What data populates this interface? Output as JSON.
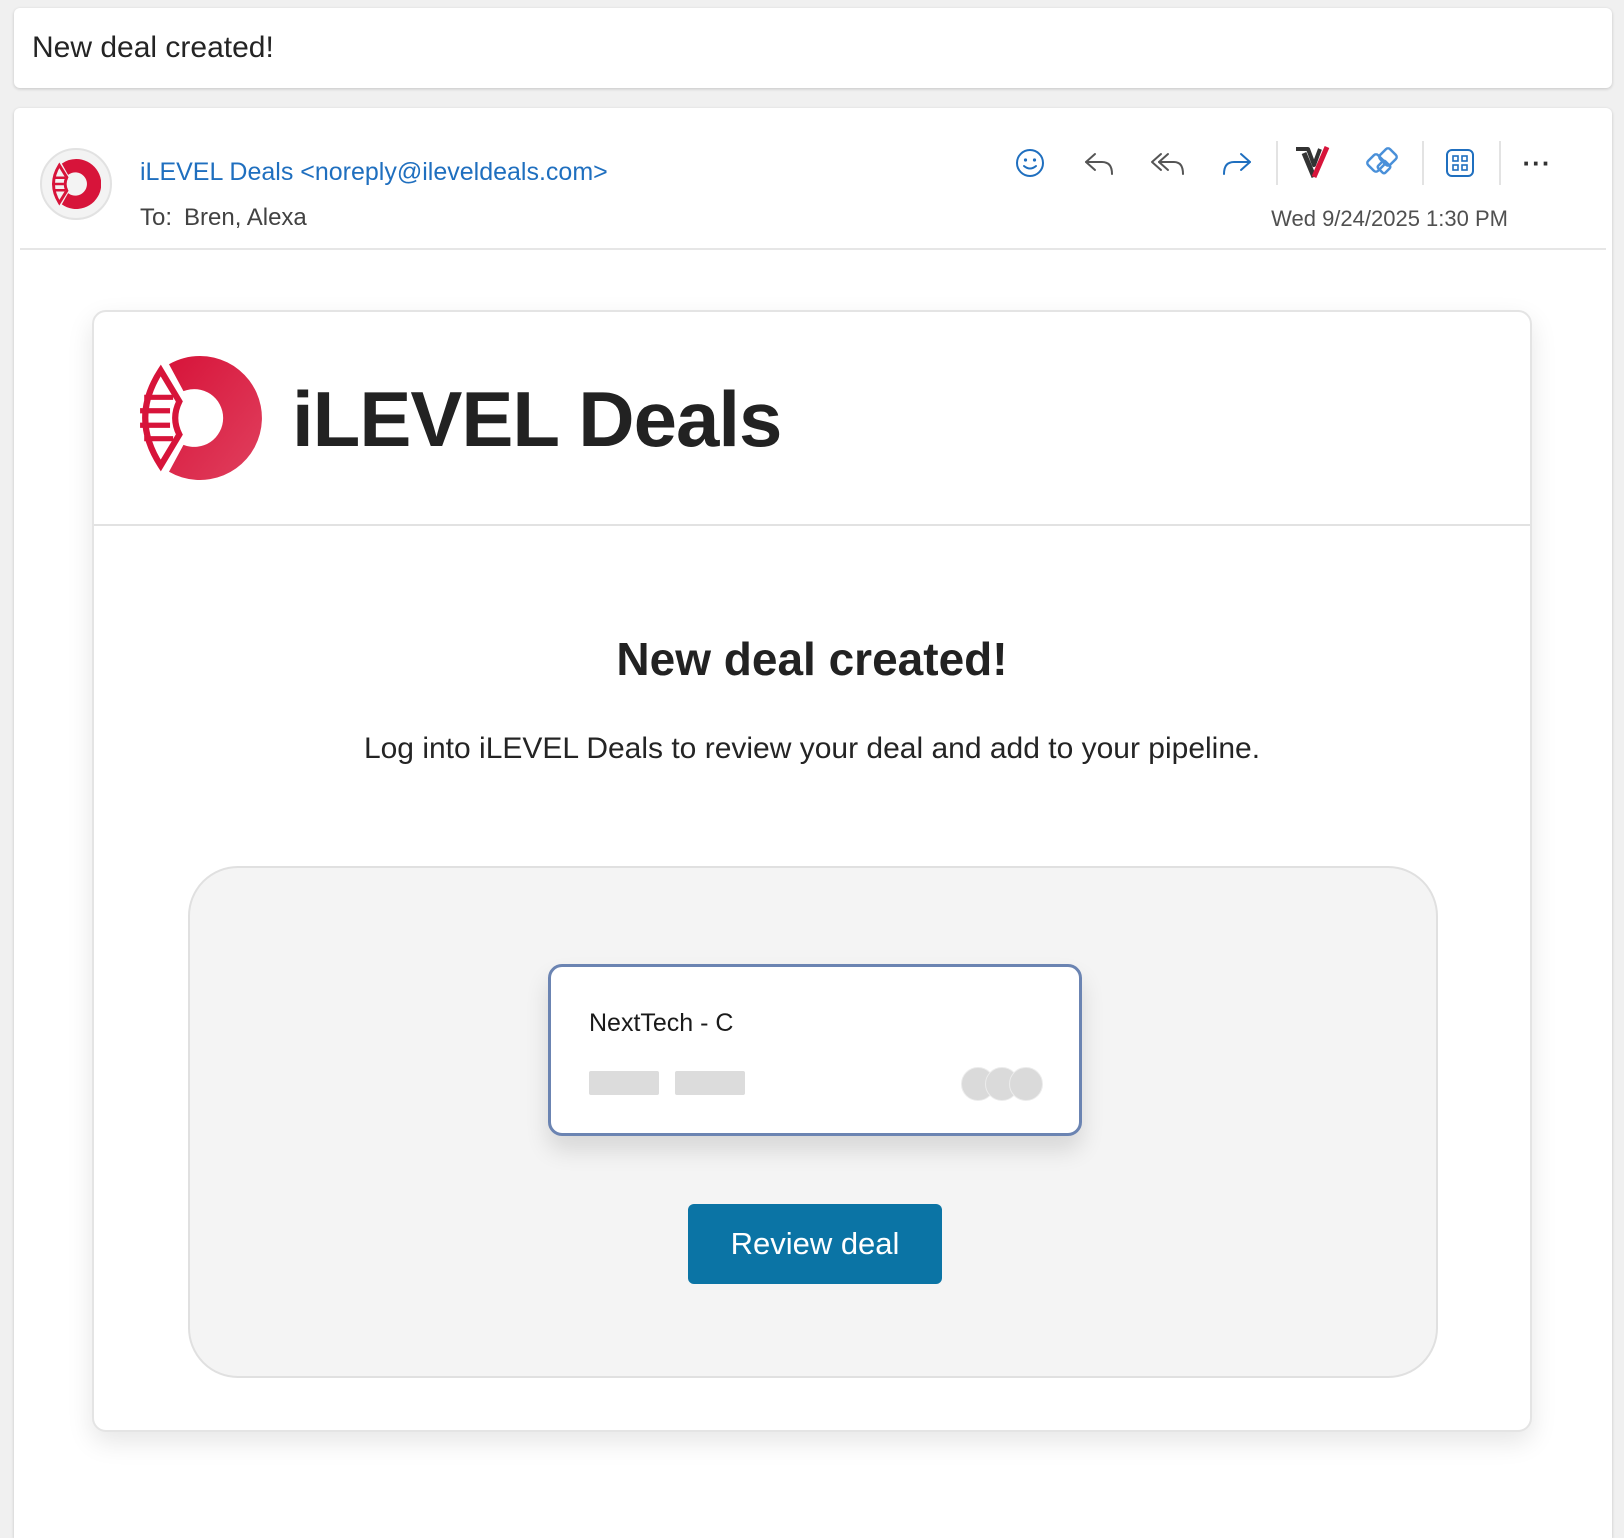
{
  "subject": "New deal created!",
  "header": {
    "sender": "iLEVEL Deals <noreply@ileveldeals.com>",
    "to_label": "To:",
    "recipients": "Bren, Alexa",
    "timestamp": "Wed 9/24/2025 1:30 PM",
    "toolbar": {
      "icons": [
        "smiley-icon",
        "reply-icon",
        "reply-all-icon",
        "forward-icon",
        "addin-v-icon",
        "loop-icon",
        "apps-icon",
        "more-icon"
      ],
      "more_label": "···"
    }
  },
  "body": {
    "brand_name": "iLEVEL Deals",
    "headline": "New deal created!",
    "subtext": "Log into iLEVEL Deals to review your deal and add to your pipeline.",
    "deal_card": {
      "title": "NextTech - C"
    },
    "cta_label": "Review deal"
  },
  "colors": {
    "accent_link": "#1f6fbf",
    "brand_red": "#d7143a",
    "button_blue": "#0b74a5",
    "deal_card_border": "#6b84b2"
  }
}
